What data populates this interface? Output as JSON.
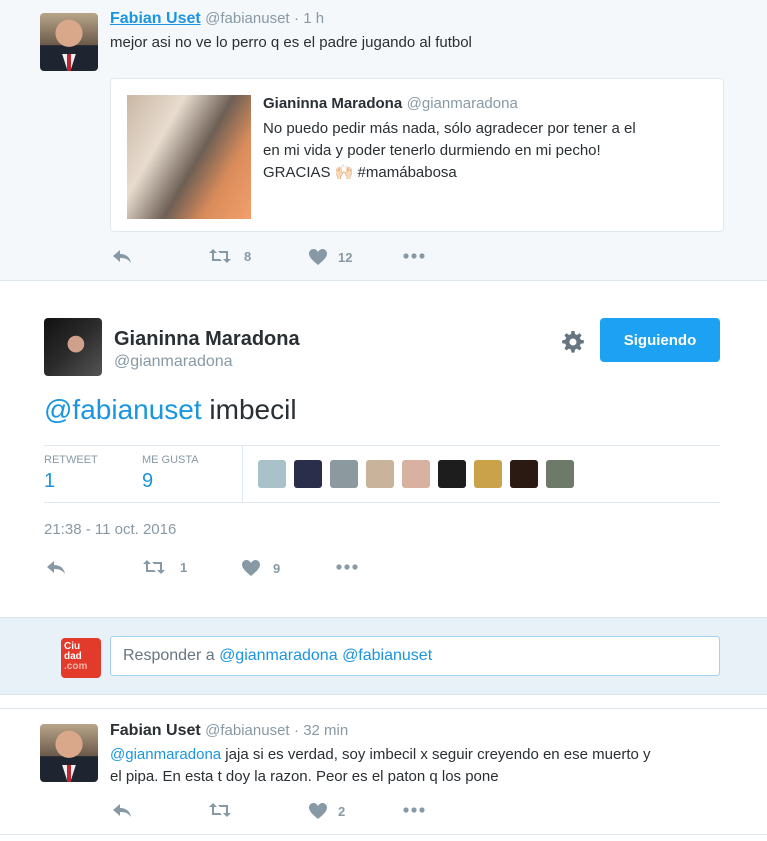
{
  "top_tweet": {
    "name": "Fabian Uset",
    "handle": "@fabianuset",
    "time": "· 1 h",
    "text": "mejor asi no ve lo perro q es el padre jugando al futbol",
    "quoted": {
      "name": "Gianinna Maradona",
      "handle": "@gianmaradona",
      "line1": "No puedo pedir más nada, sólo agradecer por tener a el",
      "line2": "en mi vida y poder tenerlo durmiendo en mi pecho!",
      "line3_prefix": "GRACIAS",
      "line3_emoji": "🙌🏻",
      "line3_hashtag": "#mamábabosa"
    },
    "actions": {
      "retweets": "8",
      "likes": "12"
    }
  },
  "main_tweet": {
    "name": "Gianinna Maradona",
    "handle": "@gianmaradona",
    "follow_label": "Siguiendo",
    "mention": "@fabianuset",
    "text": " imbecil",
    "stats": {
      "retweet_label": "RETWEET",
      "retweet_value": "1",
      "likes_label": "ME GUSTA",
      "likes_value": "9"
    },
    "timestamp": "21:38 - 11 oct. 2016",
    "actions": {
      "retweets": "1",
      "likes": "9"
    },
    "liker_avatar_colors": [
      "#a9c1c9",
      "#2a2e4a",
      "#8c9aa0",
      "#c9b39a",
      "#d8b1a1",
      "#1d1d1d",
      "#c9a24a",
      "#2a1a12",
      "#6d7a6a"
    ]
  },
  "reply": {
    "logo_line1": "Ciu",
    "logo_line2": "dad",
    "logo_line3": ".com",
    "prefix": "Responder a ",
    "mention1": "@gianmaradona",
    "mention2": "@fabianuset"
  },
  "last_tweet": {
    "name": "Fabian Uset",
    "handle": "@fabianuset",
    "time": "· 32 min",
    "mention": "@gianmaradona",
    "text_line1": " jaja si es verdad, soy imbecil x seguir creyendo en ese muerto y",
    "text_line2": "el pipa. En esta t doy la razon. Peor es el paton q los pone",
    "actions": {
      "retweets": "",
      "likes": "2"
    }
  }
}
